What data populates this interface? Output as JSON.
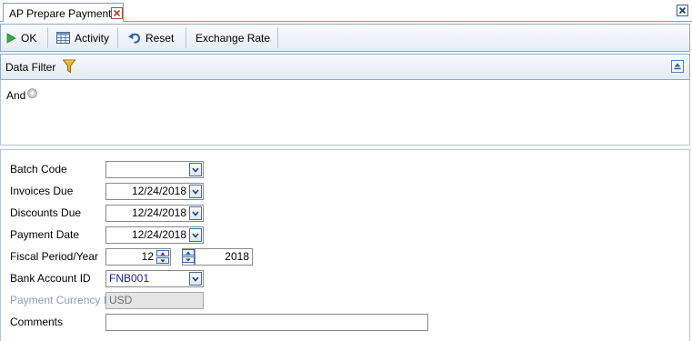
{
  "tab": {
    "title": "AP Prepare Payments"
  },
  "toolbar": {
    "ok_label": "OK",
    "activity_label": "Activity",
    "reset_label": "Reset",
    "exchange_rate_label": "Exchange Rate"
  },
  "filter": {
    "title": "Data Filter",
    "and_label": "And"
  },
  "form": {
    "batch_code": {
      "label": "Batch Code",
      "value": ""
    },
    "invoices_due": {
      "label": "Invoices Due",
      "value": "12/24/2018"
    },
    "discounts_due": {
      "label": "Discounts Due",
      "value": "12/24/2018"
    },
    "payment_date": {
      "label": "Payment Date",
      "value": "12/24/2018"
    },
    "fiscal_period_year": {
      "label": "Fiscal Period/Year",
      "period": "12",
      "separator": "/",
      "year": "2018"
    },
    "bank_account_id": {
      "label": "Bank Account ID",
      "value": "FNB001",
      "color": "#1a1aa6"
    },
    "payment_currency_id": {
      "label": "Payment Currency ID",
      "value": "USD"
    },
    "comments": {
      "label": "Comments",
      "value": ""
    }
  }
}
